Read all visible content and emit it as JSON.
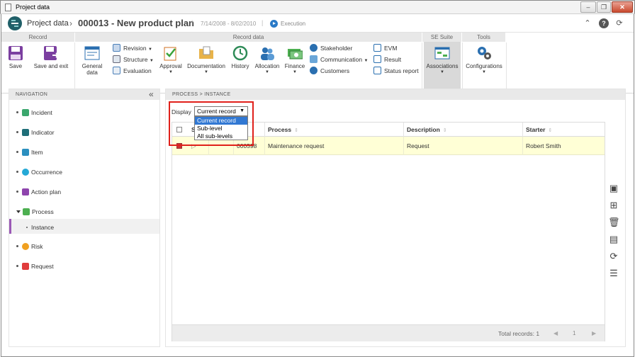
{
  "window": {
    "title": "Project data",
    "controls": [
      "minimize",
      "restore",
      "close"
    ]
  },
  "header": {
    "app": "Project data",
    "record": "000013 - New product plan",
    "dates": "7/14/2008 - 8/02/2010",
    "status": "Execution"
  },
  "ribbon": {
    "groups": {
      "record": "Record",
      "record_data": "Record data",
      "se_suite": "SE Suite",
      "tools": "Tools"
    },
    "buttons": {
      "save": "Save",
      "save_exit": "Save and exit",
      "general_data": "General data",
      "revision": "Revision",
      "structure": "Structure",
      "evaluation": "Evaluation",
      "approval": "Approval",
      "documentation": "Documentation",
      "history": "History",
      "allocation": "Allocation",
      "finance": "Finance",
      "stakeholder": "Stakeholder",
      "communication": "Communication",
      "customers": "Customers",
      "evm": "EVM",
      "result": "Result",
      "status_report": "Status report",
      "associations": "Associations",
      "configurations": "Configurations"
    }
  },
  "navigation": {
    "title": "NAVIGATION",
    "items": [
      {
        "label": "Incident",
        "color": "#3aa76d"
      },
      {
        "label": "Indicator",
        "color": "#1e6e78"
      },
      {
        "label": "Item",
        "color": "#2b8fbf"
      },
      {
        "label": "Occurrence",
        "color": "#25a9d6"
      },
      {
        "label": "Action plan",
        "color": "#8e44ad"
      },
      {
        "label": "Process",
        "color": "#4caf50"
      },
      {
        "label": "Instance",
        "color": ""
      },
      {
        "label": "Risk",
        "color": "#f0a020"
      },
      {
        "label": "Request",
        "color": "#e03c3c"
      }
    ]
  },
  "main": {
    "breadcrumb": "PROCESS  >  INSTANCE",
    "display_label": "Display",
    "display_value": "Current record",
    "display_options": [
      "Current record",
      "Sub-level",
      "All sub-levels"
    ],
    "columns": [
      "S",
      "Process",
      "Description",
      "Starter"
    ],
    "rows": [
      {
        "id_fragment": "000598",
        "process": "Maintenance request",
        "description": "Request",
        "starter": "Robert Smith"
      }
    ],
    "total_records": "Total records: 1",
    "page": "1"
  },
  "colors": {
    "accent": "#3178d3",
    "highlight_row": "#ffffd6",
    "annotation_box": "#e0201a",
    "nav_selected_bar": "#9b59b6"
  }
}
